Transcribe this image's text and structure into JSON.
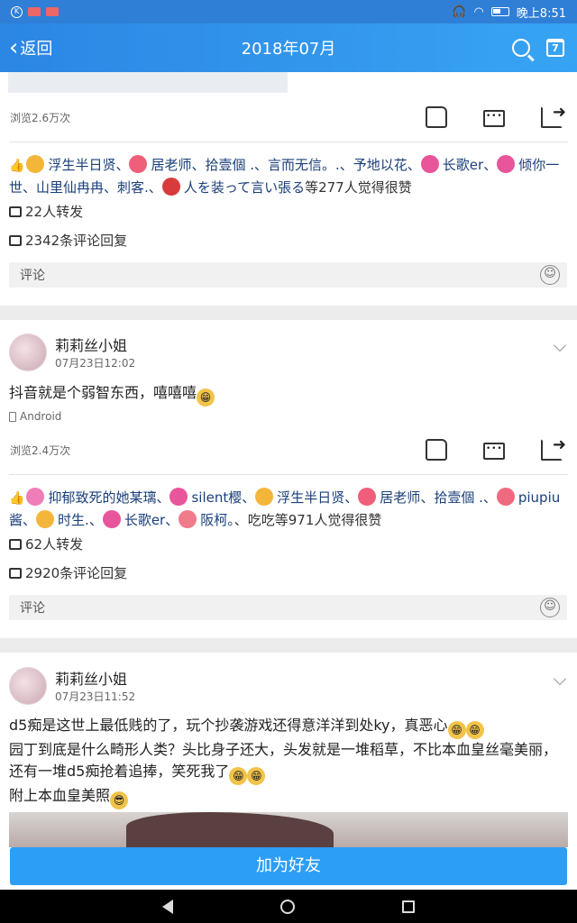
{
  "status_bar": {
    "time": "晚上8:51"
  },
  "nav": {
    "back_label": "返回",
    "title": "2018年07月",
    "calendar_day": "7"
  },
  "post1": {
    "views": "浏览2.6万次",
    "likes_parts": [
      "浮生半日贤",
      "、",
      "居老师",
      "、拾壹個 .、言而无信。.、予地以花、",
      "长歌er",
      "、",
      "倾你一世",
      "、山里仙冉冉",
      "、刺客.、",
      "人を装って言い張る",
      "等277人觉得很赞"
    ],
    "reposts": "22人转发",
    "comments_count": "2342条评论回复",
    "comment_placeholder": "评论"
  },
  "post2": {
    "username": "莉莉丝小姐",
    "time": "07月23日12:02",
    "text": "抖音就是个弱智东西，嘻嘻嘻",
    "device": "Android",
    "views": "浏览2.4万次",
    "likes_parts": [
      "抑郁致死的她",
      "某璃、",
      "silent樱",
      "、",
      "浮生半日贤",
      "、",
      "居老师",
      "、拾壹個 .、",
      "piupiu酱",
      "、",
      "时生.",
      "、",
      "长歌er",
      "、",
      "阪柯。",
      "、吃吃等971人觉得很赞"
    ],
    "reposts": "62人转发",
    "comments_count": "2920条评论回复",
    "comment_placeholder": "评论"
  },
  "post3": {
    "username": "莉莉丝小姐",
    "time": "07月23日11:52",
    "line1": "d5痴是这世上最低贱的了，玩个抄袭游戏还得意洋洋到处ky，真恶心",
    "line2": "园丁到底是什么畸形人类？头比身子还大，头发就是一堆稻草，不比本血皇丝毫美丽，还有一堆d5痴抢着追捧，笑死我了",
    "line3": "附上本血皇美照"
  },
  "add_friend_label": "加为好友",
  "colors": {
    "accent": "#2d9ef5",
    "link": "#1a3f7a"
  }
}
